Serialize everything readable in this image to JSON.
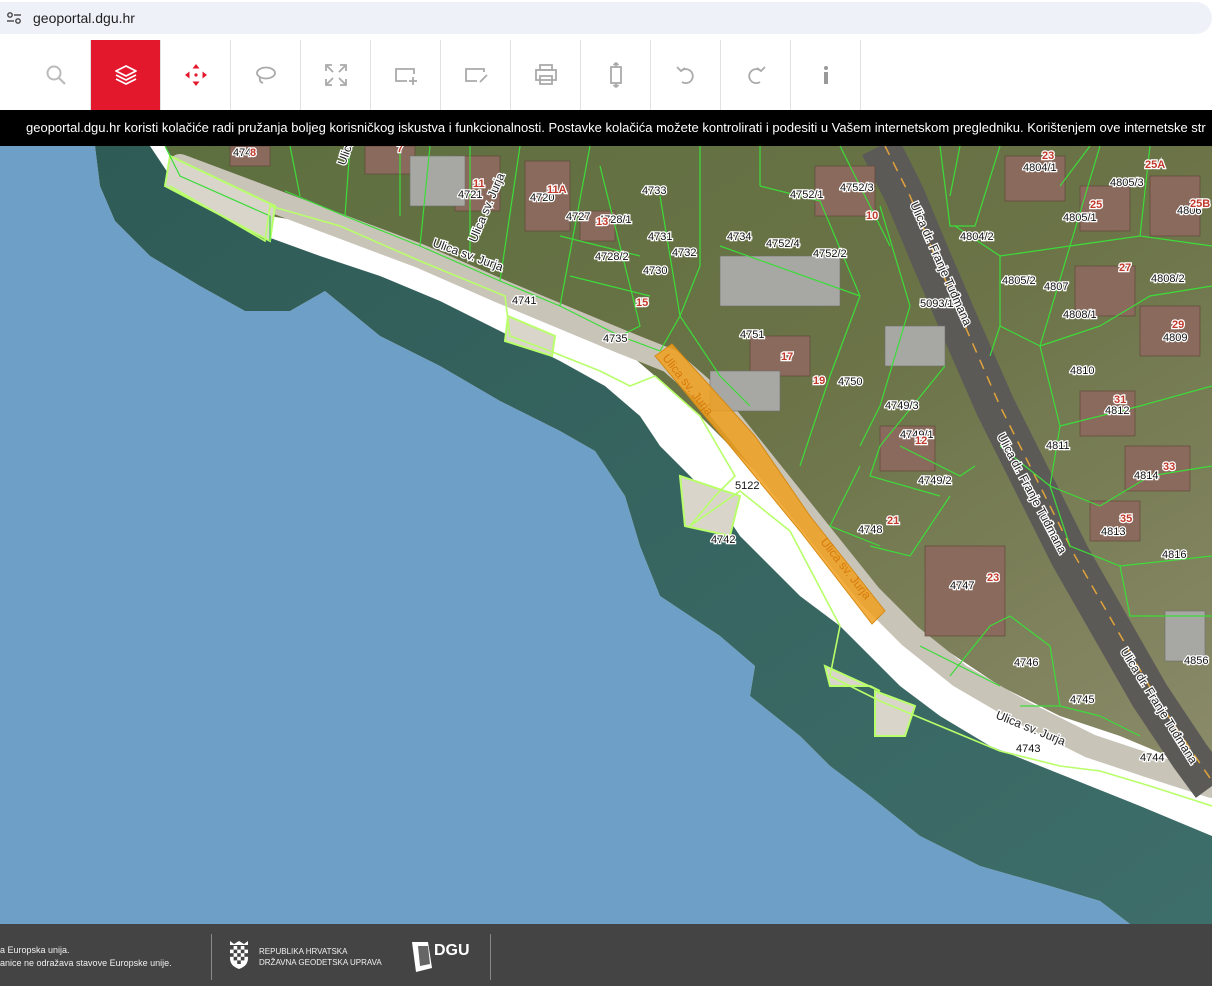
{
  "browser": {
    "url": "geoportal.dgu.hr",
    "site_icon": "site-settings-icon"
  },
  "toolbar": {
    "tools": [
      {
        "name": "search-tool",
        "icon": "search-icon",
        "active": false
      },
      {
        "name": "layers-tool",
        "icon": "layers-icon",
        "active": true
      },
      {
        "name": "pan-tool",
        "icon": "move-arrows-icon",
        "active": false
      },
      {
        "name": "lasso-tool",
        "icon": "lasso-icon",
        "active": false
      },
      {
        "name": "full-extent-tool",
        "icon": "expand-icon",
        "active": false
      },
      {
        "name": "add-area-tool",
        "icon": "add-rectangle-icon",
        "active": false
      },
      {
        "name": "edit-area-tool",
        "icon": "edit-rectangle-icon",
        "active": false
      },
      {
        "name": "print-tool",
        "icon": "print-icon",
        "active": false
      },
      {
        "name": "measure-tool",
        "icon": "measure-vertical-icon",
        "active": false
      },
      {
        "name": "undo-tool",
        "icon": "undo-icon",
        "active": false
      },
      {
        "name": "redo-tool",
        "icon": "redo-icon",
        "active": false
      },
      {
        "name": "info-tool",
        "icon": "info-icon",
        "active": false
      }
    ],
    "active_color": "#e3182d"
  },
  "cookie_banner": {
    "text": "geoportal.dgu.hr koristi kolačiće radi pružanja boljeg korisničkog iskustva i funkcionalnosti. Postavke kolačića možete kontrolirati i podesiti u Vašem internetskom pregledniku. Korištenjem ove internetske str"
  },
  "map": {
    "colors": {
      "sea": "#6e9fc7",
      "parcel_line": "#3ddc3a",
      "highlight": "#f0a020",
      "shore": "#ffffff"
    },
    "streets": [
      "Ulica sv. Jurja",
      "Ulica sv. Jurja",
      "Ulica sv. Jurja",
      "Ulica dr. Franje Tuđmana",
      "Ulica dr. Franje Tuđmana",
      "Ulica dr. Franje Tuđmana",
      "Ulica"
    ],
    "highlighted_street_labels": [
      "Ulica sv. Jurja",
      "Ulica sv. Jurja"
    ],
    "parcels": [
      "4733",
      "4752/1",
      "4752/3",
      "4721",
      "4720",
      "4727",
      "4728/1",
      "4731",
      "4732",
      "4734",
      "4752/4",
      "4752/2",
      "4728/2",
      "4730",
      "4741",
      "4735",
      "4751",
      "4750",
      "4749/3",
      "4749/1",
      "4749/2",
      "5122",
      "4742",
      "4748",
      "4747",
      "4746",
      "4745",
      "4743",
      "4744",
      "4804/1",
      "4805/3",
      "4805/1",
      "4804/2",
      "4805/2",
      "4807",
      "4808/2",
      "4808/1",
      "5093/1",
      "4809",
      "4810",
      "4812",
      "4811",
      "4814",
      "4813",
      "4816",
      "4806",
      "4856",
      "474"
    ],
    "house_numbers": [
      "8",
      "7",
      "11",
      "11A",
      "13",
      "10",
      "15",
      "17",
      "19",
      "12",
      "21",
      "23",
      "23",
      "25",
      "25A",
      "25B",
      "27",
      "29",
      "31",
      "33",
      "35"
    ]
  },
  "footer": {
    "eu_line1": "a Europska unija.",
    "eu_line2": "anice ne odražava stavove Europske unije.",
    "gov_line1": "REPUBLIKA HRVATSKA",
    "gov_line2": "DRŽAVNA GEODETSKA UPRAVA",
    "dgu_text": "DGU"
  }
}
